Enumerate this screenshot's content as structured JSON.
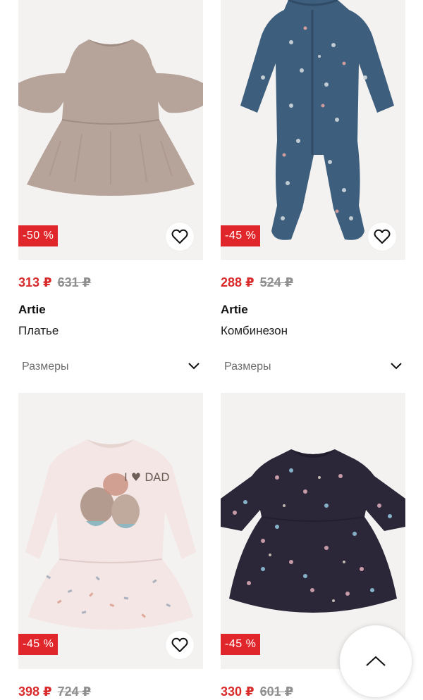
{
  "products": [
    {
      "discount": "-50 %",
      "price": "313 ₽",
      "old_price": "631 ₽",
      "brand": "Artie",
      "name": "Платье",
      "sizes_label": "Размеры"
    },
    {
      "discount": "-45 %",
      "price": "288 ₽",
      "old_price": "524 ₽",
      "brand": "Artie",
      "name": "Комбинезон",
      "sizes_label": "Размеры"
    },
    {
      "discount": "-45 %",
      "price": "398 ₽",
      "old_price": "724 ₽"
    },
    {
      "discount": "-45 %",
      "price": "330 ₽",
      "old_price": "601 ₽"
    }
  ],
  "print_text": "I ♥ DAD",
  "icons": {
    "favorite": "heart-outline-icon",
    "sizes_toggle": "chevron-down-icon",
    "scroll_top": "chevron-up-icon"
  },
  "colors": {
    "badge": "#e0262a",
    "price_new": "#d92b2b",
    "price_old": "#8f8f8f"
  }
}
